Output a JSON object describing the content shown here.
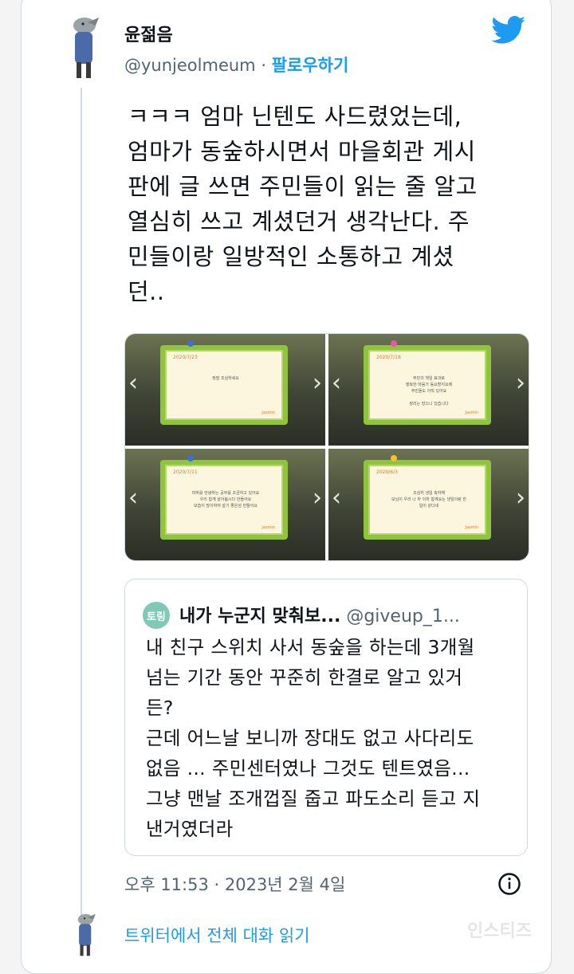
{
  "tweet": {
    "author_name": "윤젊음",
    "author_handle": "@yunjeolmeum",
    "separator": "·",
    "follow_label": "팔로우하기",
    "text_lines": [
      "ㅋㅋㅋ 엄마 닌텐도 사드렸었는데,",
      "엄마가 동숲하시면서 마을회관 게시",
      "판에 글 쓰면 주민들이 읽는 줄 알고",
      "열심히 쓰고 계셨던거 생각난다. 주",
      "민들이랑 일방적인 소통하고 계셨",
      "던.."
    ],
    "timestamp": "오후 11:53 · 2023년 2월 4일"
  },
  "media": {
    "panels": [
      {
        "date": "2020/7/23",
        "message": "정말 조심하세요",
        "sign": "Jasmin",
        "pin_color": "#3d6fd1",
        "nav_left": "‹",
        "nav_right": "›"
      },
      {
        "date": "2020/7/18",
        "message": "주민의 책임 효과로\n행복한 마음가 동요할지요에\n주민들도 아직 있어요\n\n정리는 많으니 있습니다",
        "sign": "Jasmin",
        "pin_color": "#e45aa5",
        "nav_left": "‹",
        "nav_right": "›"
      },
      {
        "date": "2020/7/11",
        "message": "마하를 안녕하는 공부를 조금하고 있어요\n우리 함께 살아봅시다 만들어요\n모습이 많이하여 살기 좋은섬 만들어요",
        "sign": "Jasmin",
        "pin_color": "#3d6fd1",
        "nav_left": "‹",
        "nav_right": "›"
      },
      {
        "date": "2020/6/3",
        "message": "조심히 생일 축하해\n모님이 우리 나 하 이하 함께요는 생일이랑 한\n일이 같다네",
        "sign": "Jasmin",
        "pin_color": "#f2c230",
        "nav_left": "‹",
        "nav_right": "›"
      }
    ]
  },
  "quote": {
    "avatar_text": "토링",
    "name": "내가 누군지 맞춰보...",
    "handle": "@giveup_1...",
    "text_lines": [
      "내 친구 스위치 사서 동숲을 하는데 3개월",
      "넘는 기간 동안 꾸준히 한결로 알고 있거",
      "든?",
      "근데 어느날 보니까 장대도 없고 사다리도",
      "없음 ... 주민센터였나 그것도 텐트였음...",
      "그냥 맨날 조개껍질 줍고 파도소리 듣고 지",
      "낸거였더라"
    ]
  },
  "footer": {
    "reply_link": "트위터에서 전체 대화 읽기",
    "watermark": "인스티즈"
  },
  "colors": {
    "accent": "#1d9bf0",
    "secondary_text": "#536471",
    "border": "#cfd9de"
  },
  "icons": [
    "twitter-bird-icon",
    "info-icon",
    "author-avatar",
    "quote-avatar"
  ]
}
